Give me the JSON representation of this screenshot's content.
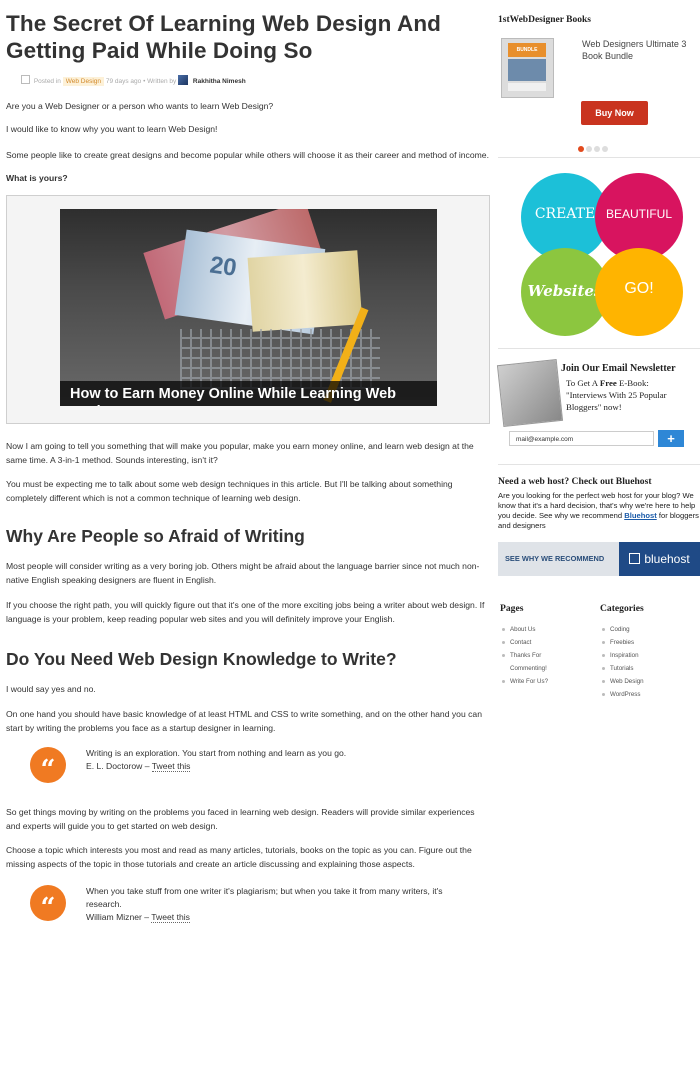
{
  "article": {
    "title": "The Secret Of Learning Web Design And Getting Paid While Doing So",
    "meta": {
      "posted_in_label": "Posted in",
      "category": "Web Design",
      "age": "79 days ago",
      "written_by_label": "Written by",
      "author": "Rakhitha Nimesh"
    },
    "intro": [
      "Are you a Web Designer or a person who wants to learn Web Design?",
      "I would like to know why you want to learn Web Design!",
      "Some people like to create great designs and become popular while others will choose it as their career and method of income."
    ],
    "question": "What is yours?",
    "image_caption": "How to Earn Money Online While Learning Web Design",
    "image_bill_number": "20",
    "after_image": [
      "Now I am going to tell you something that will make you popular, make you earn money online, and learn web design at the same time.  A 3-in-1 method. Sounds interesting, isn't it?",
      "You must be expecting me to talk about some web design techniques in this article. But I'll be talking about something completely different which is not a common technique of learning web design."
    ],
    "section1": {
      "heading": "Why Are People so Afraid of Writing",
      "paragraphs": [
        "Most people will consider writing as a very boring job. Others might be afraid about the language barrier since not much non-native English speaking designers are fluent in English.",
        "If you choose the right path, you will quickly figure out that it's one of the more exciting jobs being a writer about web design. If language is your problem, keep reading popular web sites and you will definitely improve your English."
      ]
    },
    "section2": {
      "heading": "Do You Need Web Design Knowledge to Write?",
      "paragraphs": [
        "I would say yes and no.",
        "On one hand you should have basic knowledge of at least HTML and CSS to write something, and on the other hand you can start by writing the problems you face as a startup designer in learning."
      ],
      "quote1": {
        "text": "Writing is an exploration. You start from nothing and learn as you go.",
        "author": "E. L. Doctorow –",
        "tweet": "Tweet this"
      },
      "more": [
        "So get things moving by writing on the problems you faced in learning web design. Readers will provide similar experiences and experts will guide you to get started on web design.",
        "Choose a topic which interests you most and read as many articles, tutorials, books on the topic as you can. Figure out the missing aspects of the topic in those tutorials and create an article discussing and explaining those aspects."
      ],
      "quote2": {
        "text": "When you take stuff from one writer it's plagiarism; but when you take it from many writers, it's research.",
        "author": "William Mizner –",
        "tweet": "Tweet this"
      }
    },
    "quote_mark": "“"
  },
  "sidebar": {
    "books": {
      "title": "1stWebDesigner Books",
      "book_cover_label": "BUNDLE",
      "book_name": "Web Designers Ultimate 3 Book Bundle",
      "buy_label": "Buy Now",
      "slides": 4,
      "active_slide": 1
    },
    "venn": {
      "labels": [
        "CREATE",
        "BEAUTIFUL",
        "Websites",
        "GO!"
      ],
      "colors": [
        "#1cc0d8",
        "#d8145f",
        "#8cc63f",
        "#ffb400"
      ]
    },
    "newsletter": {
      "title": "Join Our Email Newsletter",
      "line1_prefix": "To Get A",
      "line1_free": "Free",
      "line1_suffix": "E-Book:",
      "line2": "\"Interviews With 25 Popular Bloggers\" now!",
      "email_value": "mail@example.com",
      "submit_label": "+"
    },
    "hosting": {
      "title": "Need a web host? Check out Bluehost",
      "text_before": "Are you looking for the perfect web host for your blog? We know that it's a hard decision, that's why we're here to help you decide. See why we recommend",
      "link": "Bluehost",
      "text_after": "for bloggers and designers",
      "banner_cta": "SEE WHY WE RECOMMEND",
      "banner_logo": "bluehost"
    },
    "pages": {
      "title": "Pages",
      "items": [
        "About Us",
        "Contact",
        "Thanks For Commenting!",
        "Write For Us?"
      ]
    },
    "categories": {
      "title": "Categories",
      "items": [
        "Coding",
        "Freebies",
        "Inspiration",
        "Tutorials",
        "Web Design",
        "WordPress"
      ]
    }
  }
}
